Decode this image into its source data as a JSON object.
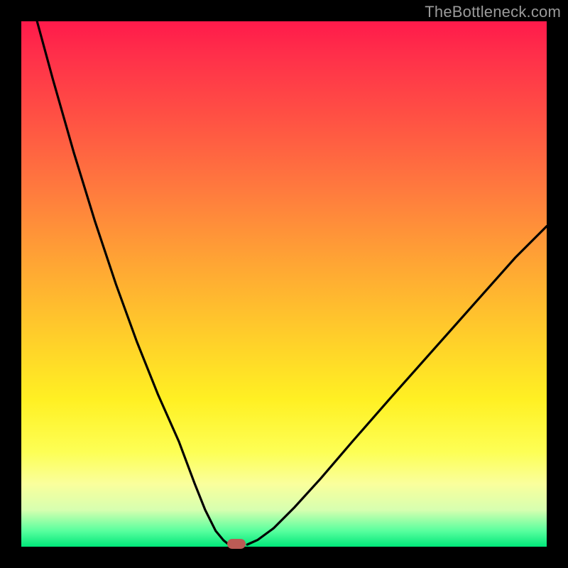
{
  "watermark": "TheBottleneck.com",
  "colors": {
    "background": "#000000",
    "gradient_top": "#ff1a4b",
    "gradient_bottom": "#00e77a",
    "curve_stroke": "#000000",
    "marker": "#bb5b55",
    "watermark": "#9a9a9a"
  },
  "chart_data": {
    "type": "line",
    "title": "",
    "xlabel": "",
    "ylabel": "",
    "xlim": [
      0,
      100
    ],
    "ylim": [
      0,
      100
    ],
    "series": [
      {
        "name": "left-branch",
        "x": [
          3,
          6,
          10,
          14,
          18,
          22,
          26,
          30,
          33,
          35,
          37,
          38.5,
          39.5
        ],
        "y": [
          100,
          89,
          75,
          62,
          50,
          39,
          29,
          20,
          12,
          7,
          3,
          1.2,
          0.4
        ]
      },
      {
        "name": "right-branch",
        "x": [
          43,
          45,
          48,
          52,
          57,
          63,
          70,
          78,
          86,
          94,
          100
        ],
        "y": [
          0.4,
          1.3,
          3.5,
          7.5,
          13,
          20,
          28,
          37,
          46,
          55,
          61
        ]
      }
    ],
    "marker": {
      "x": 41,
      "y": 0
    },
    "note": "The x-axis (horizontal) and y-axis (vertical) carry no visible tick labels. Values above are read off as percentages of the plot area (0 = left/bottom edge, 100 = right/top edge). The two branches form a V-shaped bottleneck curve meeting near x≈41 at y≈0."
  }
}
